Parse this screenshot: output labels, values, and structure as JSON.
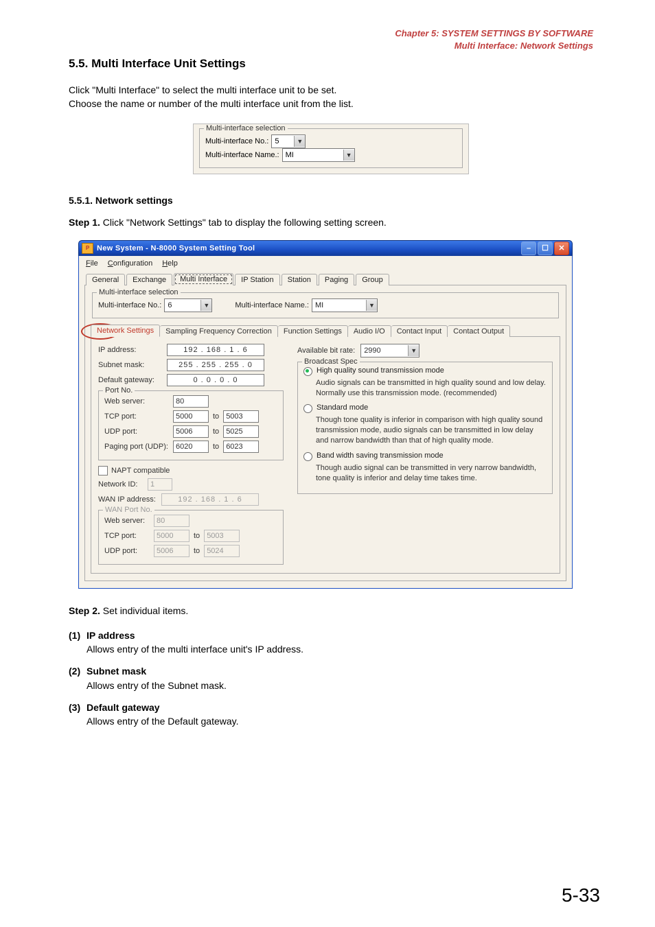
{
  "header": {
    "line1": "Chapter 5:  SYSTEM SETTINGS BY SOFTWARE",
    "line2": "Multi Interface: Network Settings"
  },
  "section_title": "5.5. Multi Interface Unit Settings",
  "intro_line1": "Click \"Multi Interface\" to select the multi interface unit to be set.",
  "intro_line2": "Choose the name or number of the multi interface unit from the list.",
  "mini": {
    "legend": "Multi-interface selection",
    "no_label": "Multi-interface No.:",
    "no_value": "5",
    "name_label": "Multi-interface Name.:",
    "name_value": "MI"
  },
  "subsection_title": "5.5.1. Network settings",
  "step1_label": "Step 1.",
  "step1_text": "Click \"Network Settings\" tab to display the following setting screen.",
  "window": {
    "title": "New System - N-8000 System Setting Tool",
    "menu": {
      "file": "File",
      "configuration": "Configuration",
      "help": "Help"
    },
    "tabs": [
      "General",
      "Exchange",
      "Multi Interface",
      "IP Station",
      "Station",
      "Paging",
      "Group"
    ],
    "active_tab_index": 2,
    "mi_selection": {
      "legend": "Multi-interface selection",
      "no_label": "Multi-interface No.:",
      "no_value": "6",
      "name_label": "Multi-interface Name.:",
      "name_value": "MI"
    },
    "subtabs": [
      "Network Settings",
      "Sampling Frequency Correction",
      "Function Settings",
      "Audio I/O",
      "Contact Input",
      "Contact Output"
    ],
    "active_subtab_index": 0,
    "left": {
      "ip_label": "IP address:",
      "ip_value": "192 . 168 .  1  .  6",
      "subnet_label": "Subnet mask:",
      "subnet_value": "255 . 255 . 255 .  0",
      "gateway_label": "Default gateway:",
      "gateway_value": "0  .  0  .  0  .  0",
      "portno_legend": "Port No.",
      "web_label": "Web server:",
      "web_value": "80",
      "tcp_label": "TCP port:",
      "tcp_from": "5000",
      "tcp_to": "5003",
      "udp_label": "UDP port:",
      "udp_from": "5006",
      "udp_to": "5025",
      "paging_label": "Paging port (UDP):",
      "paging_from": "6020",
      "paging_to": "6023",
      "to_word": "to",
      "napt_label": "NAPT compatible",
      "netid_label": "Network ID:",
      "netid_value": "1",
      "wanip_label": "WAN IP address:",
      "wanip_value": "192 . 168 .   1  .   6",
      "wanport_legend": "WAN Port No.",
      "wan_web_label": "Web server:",
      "wan_web_value": "80",
      "wan_tcp_label": "TCP port:",
      "wan_tcp_from": "5000",
      "wan_tcp_to": "5003",
      "wan_udp_label": "UDP port:",
      "wan_udp_from": "5006",
      "wan_udp_to": "5024"
    },
    "right": {
      "bitrate_label": "Available bit rate:",
      "bitrate_value": "2990",
      "bspec_legend": "Broadcast Spec",
      "opt1_title": "High quality sound transmission mode",
      "opt1_desc": "Audio signals can be transmitted in high quality sound and low delay. Normally use this transmission mode. (recommended)",
      "opt2_title": "Standard mode",
      "opt2_desc": "Though tone quality is inferior in comparison with high quality sound transmission mode, audio signals can be transmitted in low delay and narrow bandwidth than that of high quality mode.",
      "opt3_title": "Band width saving transmission mode",
      "opt3_desc": "Though audio signal can be transmitted in very narrow bandwidth, tone quality is inferior and delay time takes time."
    }
  },
  "step2_label": "Step 2.",
  "step2_text": "Set individual items.",
  "items": [
    {
      "num": "(1)",
      "title": "IP address",
      "desc": "Allows entry of the multi interface unit's IP address."
    },
    {
      "num": "(2)",
      "title": "Subnet mask",
      "desc": "Allows entry of the Subnet mask."
    },
    {
      "num": "(3)",
      "title": "Default gateway",
      "desc": "Allows entry of the Default gateway."
    }
  ],
  "page_number": "5-33"
}
